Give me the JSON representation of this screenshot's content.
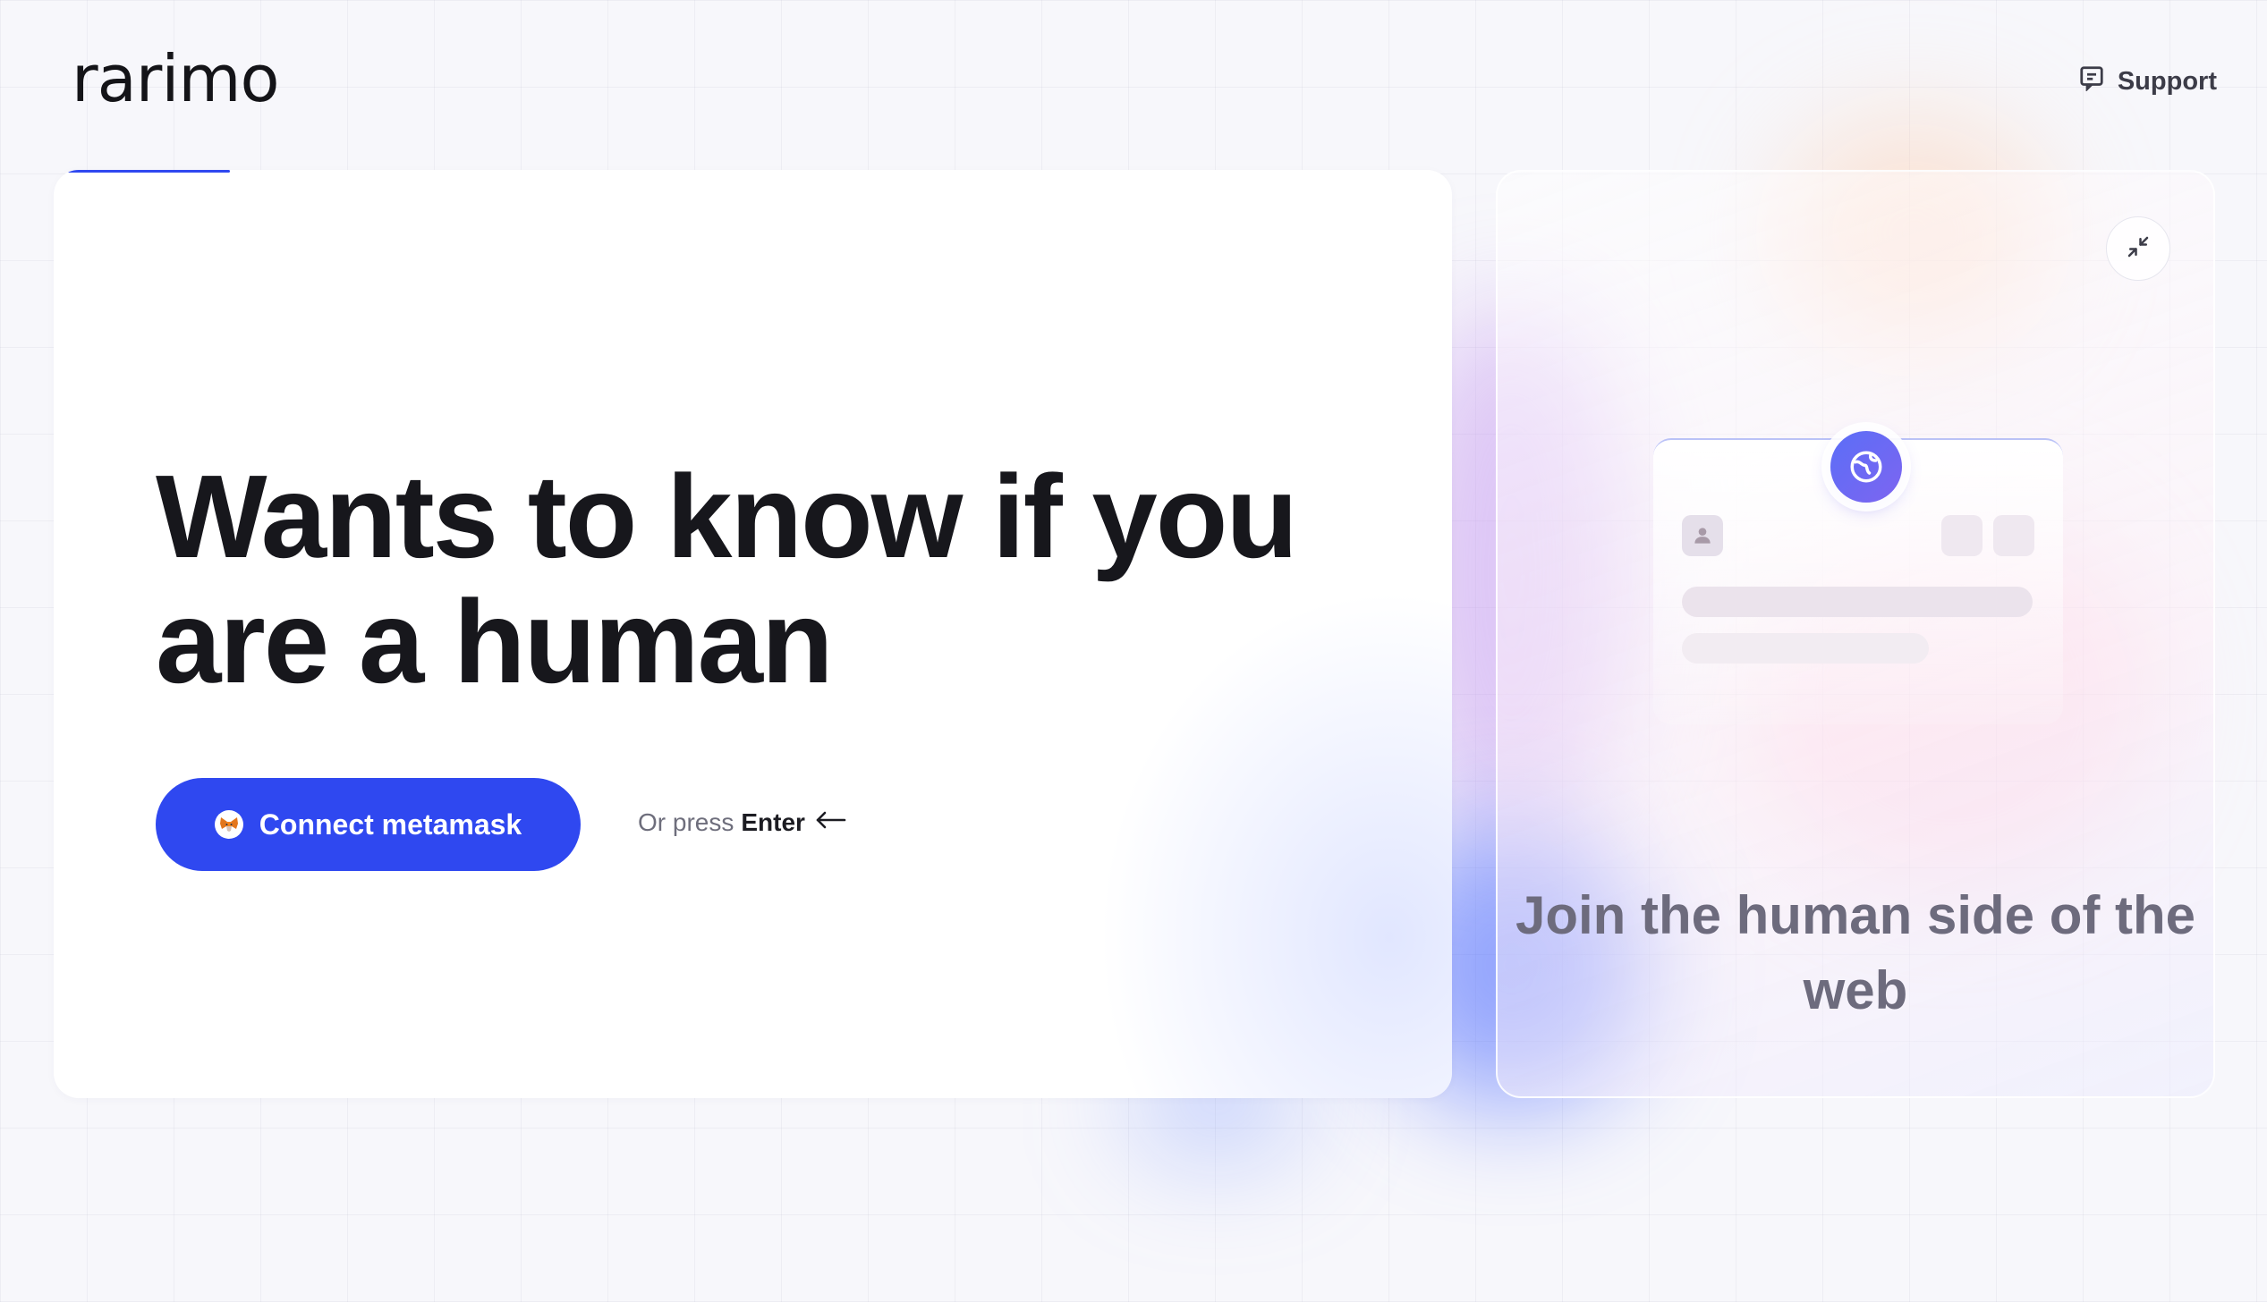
{
  "header": {
    "logo_text": "rarimo",
    "support_label": "Support",
    "support_icon": "chat-icon"
  },
  "main": {
    "headline": "Wants to know if you are a human",
    "connect_button": {
      "label": "Connect metamask",
      "icon": "metamask-fox-icon",
      "color": "#2f48f0"
    },
    "hint": {
      "prefix": "Or press",
      "key": "Enter",
      "icon": "arrow-left-icon"
    }
  },
  "side": {
    "collapse_icon": "collapse-arrows-icon",
    "caption": "Join the human side of the web",
    "illustration": {
      "globe_icon": "globe-icon",
      "avatar_icon": "user-icon"
    }
  },
  "colors": {
    "accent": "#2f48f0",
    "background": "#f7f7fb",
    "headline": "#17171c",
    "caption": "#6d6b7d"
  }
}
